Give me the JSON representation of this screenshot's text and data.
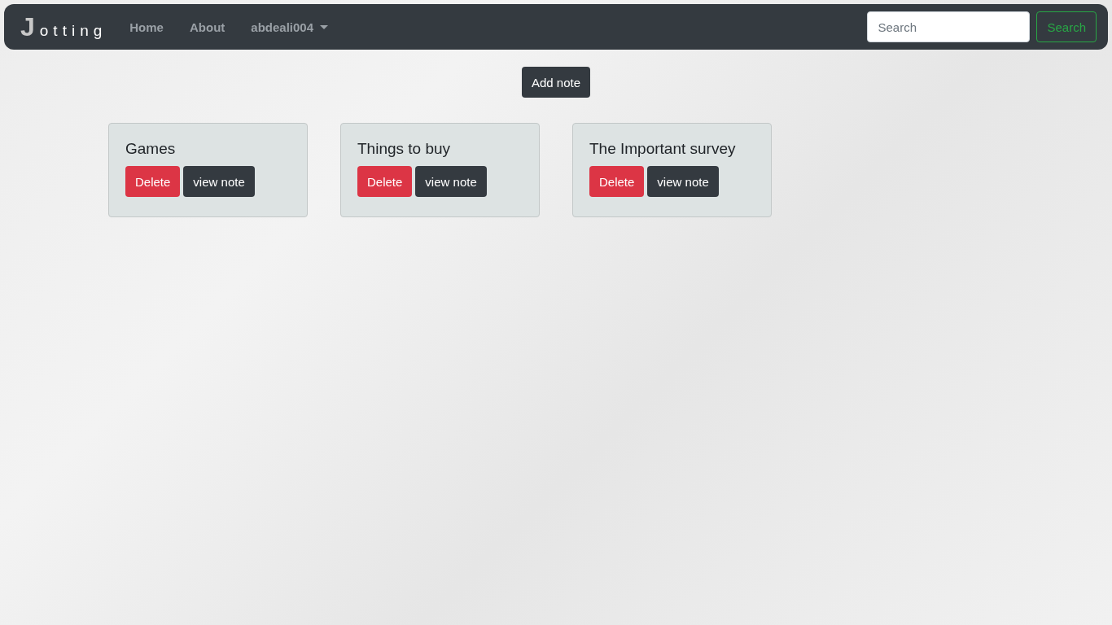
{
  "navbar": {
    "brand": "Jotting",
    "links": [
      {
        "label": "Home",
        "kind": "link"
      },
      {
        "label": "About",
        "kind": "link"
      },
      {
        "label": "abdeali004",
        "kind": "dropdown"
      }
    ],
    "search": {
      "placeholder": "Search",
      "button": "Search"
    }
  },
  "add_button": "Add note",
  "notes": [
    {
      "title": "Games",
      "delete": "Delete",
      "view": "view note"
    },
    {
      "title": "Things to buy",
      "delete": "Delete",
      "view": "view note"
    },
    {
      "title": "The Important survey",
      "delete": "Delete",
      "view": "view note"
    }
  ]
}
